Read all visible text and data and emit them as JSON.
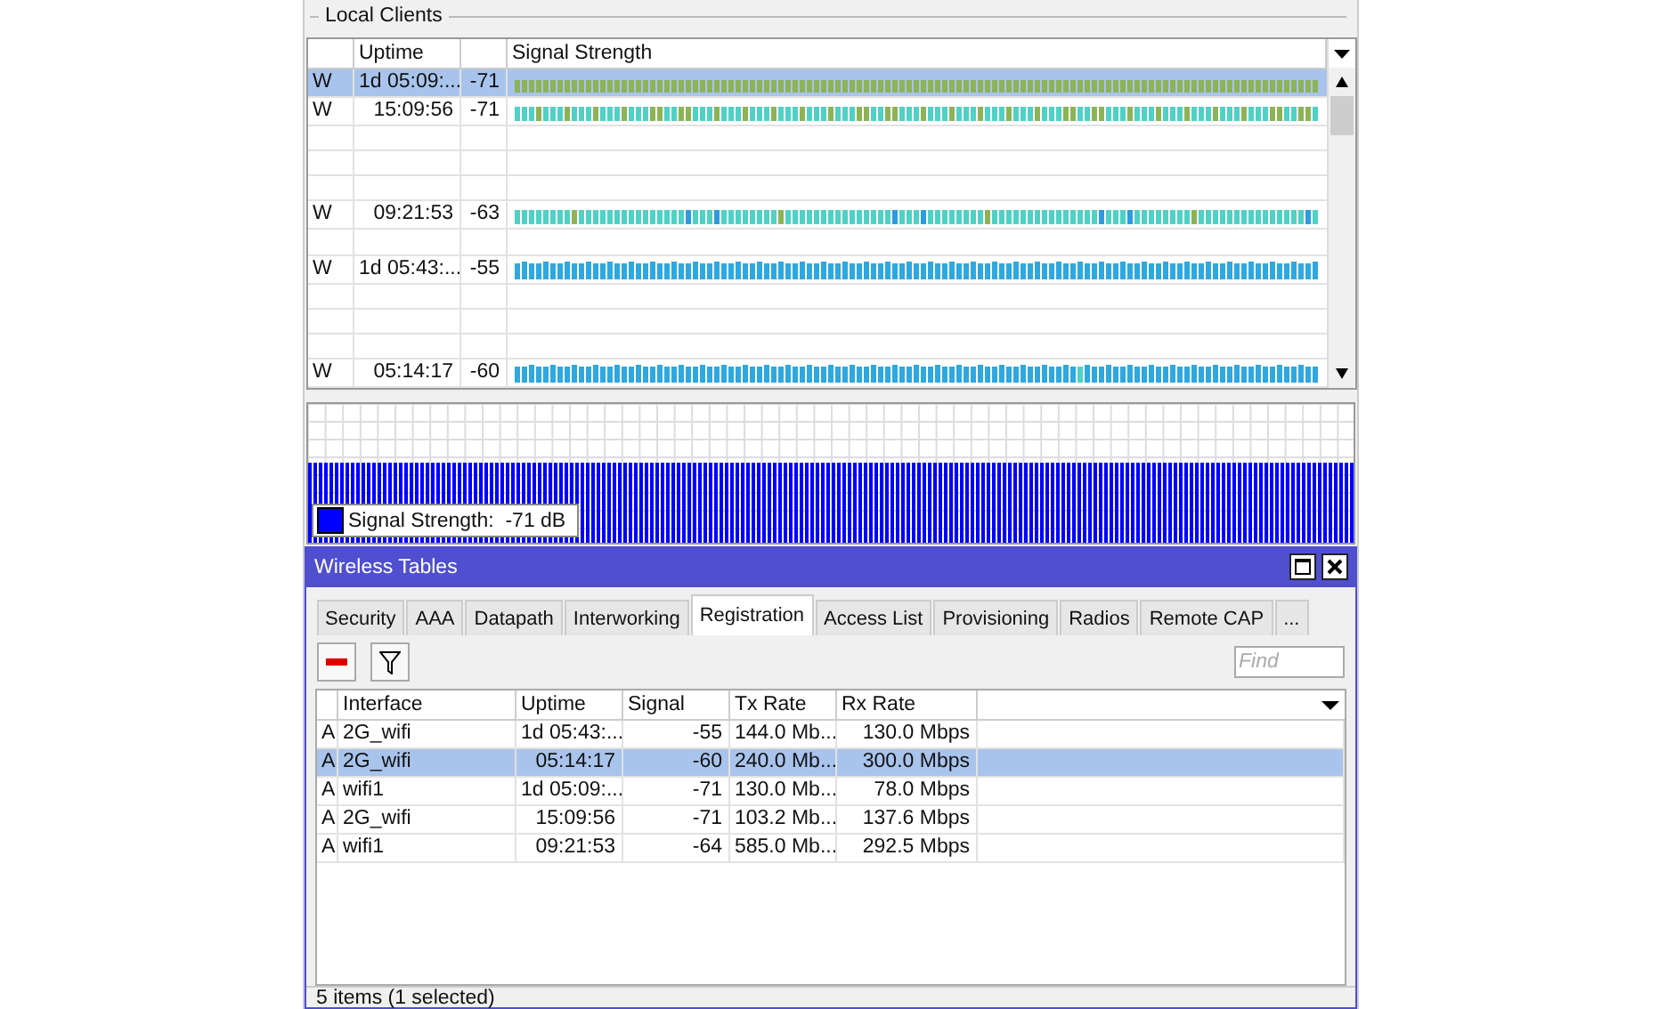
{
  "local_clients": {
    "title": "Local Clients",
    "columns": [
      "Uptime",
      "Signal Strength"
    ],
    "rows": [
      {
        "flag": "W",
        "uptime": "1d 05:09:...",
        "signal": "-71",
        "color": "#8db356",
        "selected": true
      },
      {
        "flag": "W",
        "uptime": "15:09:56",
        "signal": "-71",
        "color": "#4fd1c5",
        "selected": false
      },
      {
        "flag": "",
        "uptime": "",
        "signal": "",
        "selected": false
      },
      {
        "flag": "",
        "uptime": "",
        "signal": "",
        "selected": false
      },
      {
        "flag": "",
        "uptime": "",
        "signal": "",
        "selected": false
      },
      {
        "flag": "W",
        "uptime": "09:21:53",
        "signal": "-63",
        "color": "#4fd1c5",
        "selected": false
      },
      {
        "flag": "",
        "uptime": "",
        "signal": "",
        "selected": false
      },
      {
        "flag": "W",
        "uptime": "1d 05:43:...",
        "signal": "-55",
        "color": "#2ea8e0",
        "selected": false
      },
      {
        "flag": "",
        "uptime": "",
        "signal": "",
        "selected": false
      },
      {
        "flag": "",
        "uptime": "",
        "signal": "",
        "selected": false
      },
      {
        "flag": "",
        "uptime": "",
        "signal": "",
        "selected": false
      },
      {
        "flag": "W",
        "uptime": "05:14:17",
        "signal": "-60",
        "color": "#2ea8e0",
        "selected": false
      }
    ]
  },
  "graph": {
    "legend": "Signal Strength:  -71 dB",
    "color": "#0000ff"
  },
  "window": {
    "title": "Wireless Tables",
    "tabs": [
      {
        "label": "Security",
        "selected": false
      },
      {
        "label": "AAA",
        "selected": false
      },
      {
        "label": "Datapath",
        "selected": false
      },
      {
        "label": "Interworking",
        "selected": false
      },
      {
        "label": "Registration",
        "selected": true
      },
      {
        "label": "Access List",
        "selected": false
      },
      {
        "label": "Provisioning",
        "selected": false
      },
      {
        "label": "Radios",
        "selected": false
      },
      {
        "label": "Remote CAP",
        "selected": false
      },
      {
        "label": "...",
        "selected": false
      }
    ],
    "search": {
      "placeholder": "Find"
    },
    "columns": [
      "Interface",
      "Uptime",
      "Signal",
      "Tx Rate",
      "Rx Rate"
    ],
    "rows": [
      {
        "flag": "A",
        "interface": "2G_wifi",
        "uptime": "1d 05:43:...",
        "signal": "-55",
        "tx": "144.0 Mb...",
        "rx": "130.0 Mbps",
        "selected": false
      },
      {
        "flag": "A",
        "interface": "2G_wifi",
        "uptime": "05:14:17",
        "signal": "-60",
        "tx": "240.0 Mb...",
        "rx": "300.0 Mbps",
        "selected": true
      },
      {
        "flag": "A",
        "interface": "wifi1",
        "uptime": "1d 05:09:...",
        "signal": "-71",
        "tx": "130.0 Mb...",
        "rx": "78.0 Mbps",
        "selected": false
      },
      {
        "flag": "A",
        "interface": "2G_wifi",
        "uptime": "15:09:56",
        "signal": "-71",
        "tx": "103.2 Mb...",
        "rx": "137.6 Mbps",
        "selected": false
      },
      {
        "flag": "A",
        "interface": "wifi1",
        "uptime": "09:21:53",
        "signal": "-64",
        "tx": "585.0 Mb...",
        "rx": "292.5 Mbps",
        "selected": false
      }
    ],
    "status": "5 items (1 selected)"
  }
}
